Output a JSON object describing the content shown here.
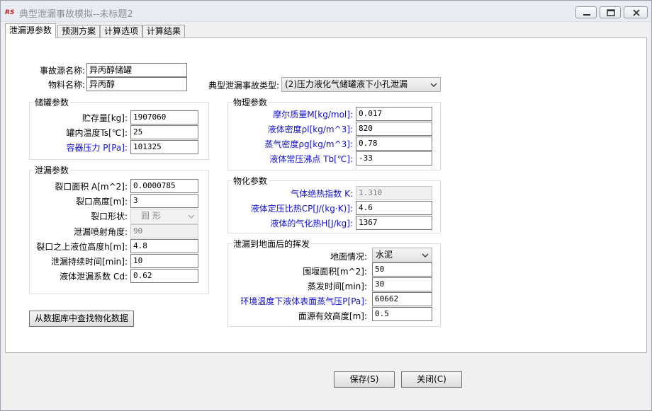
{
  "window": {
    "title": "典型泄漏事故模拟--未标题2",
    "minimize_icon": "minimize-icon",
    "maximize_icon": "maximize-icon",
    "close_icon": "close-icon"
  },
  "tabs": [
    "泄漏源参数",
    "预测方案",
    "计算选项",
    "计算结果"
  ],
  "source": {
    "name_label": "事故源名称:",
    "name_value": "异丙醇储罐",
    "material_label": "物料名称:",
    "material_value": "异丙醇",
    "type_label": "典型泄漏事故类型:",
    "type_value": "(2)压力液化气储罐液下小孔泄漏"
  },
  "storage": {
    "title": "储罐参数",
    "fields": [
      {
        "label": "贮存量[kg]:",
        "value": "1907060"
      },
      {
        "label": "罐内温度Ts[℃]:",
        "value": "25"
      },
      {
        "label": "容器压力 P[Pa]:",
        "value": "101325"
      }
    ]
  },
  "leak": {
    "title": "泄漏参数",
    "area_label": "裂口面积 A[m^2]:",
    "area_value": "0.0000785",
    "height_label": "裂口高度[m]:",
    "height_value": "3",
    "shape_label": "裂口形状:",
    "shape_value": "圆  形",
    "angle_label": "泄漏喷射角度:",
    "angle_value": "90",
    "level_label": "裂口之上液位高度h[m]:",
    "level_value": "4.8",
    "duration_label": "泄漏持续时间[min]:",
    "duration_value": "10",
    "coef_label": "液体泄漏系数  Cd:",
    "coef_value": "0.62"
  },
  "physical": {
    "title": "物理参数",
    "fields": [
      {
        "label": "摩尔质量M[kg/mol]:",
        "value": "0.017"
      },
      {
        "label": "液体密度ρl[kg/m^3]:",
        "value": "820"
      },
      {
        "label": "蒸气密度ρg[kg/m^3]:",
        "value": "0.78"
      },
      {
        "label": "液体常压沸点 Tb[℃]:",
        "value": "-33"
      }
    ]
  },
  "chemical": {
    "title": "物化参数",
    "fields": [
      {
        "label": "气体绝热指数  K:",
        "value": "1.310"
      },
      {
        "label": "液体定压比热CP[J/(kg·K)]:",
        "value": "4.6"
      },
      {
        "label": "液体的气化热H[J/kg]:",
        "value": "1367"
      }
    ]
  },
  "evaporation": {
    "title": "泄漏到地面后的挥发",
    "ground_label": "地面情况:",
    "ground_value": "水泥",
    "area_label": "围堰面积[m^2]:",
    "area_value": "50",
    "time_label": "蒸发时间[min]:",
    "time_value": "30",
    "pressure_label": "环境温度下液体表面蒸气压P[Pa]:",
    "pressure_value": "60662",
    "height_label": "面源有效高度[m]:",
    "height_value": "0.5"
  },
  "buttons": {
    "lookup": "从数据库中查找物化数据",
    "save": "保存(S)",
    "close": "关闭(C)"
  }
}
